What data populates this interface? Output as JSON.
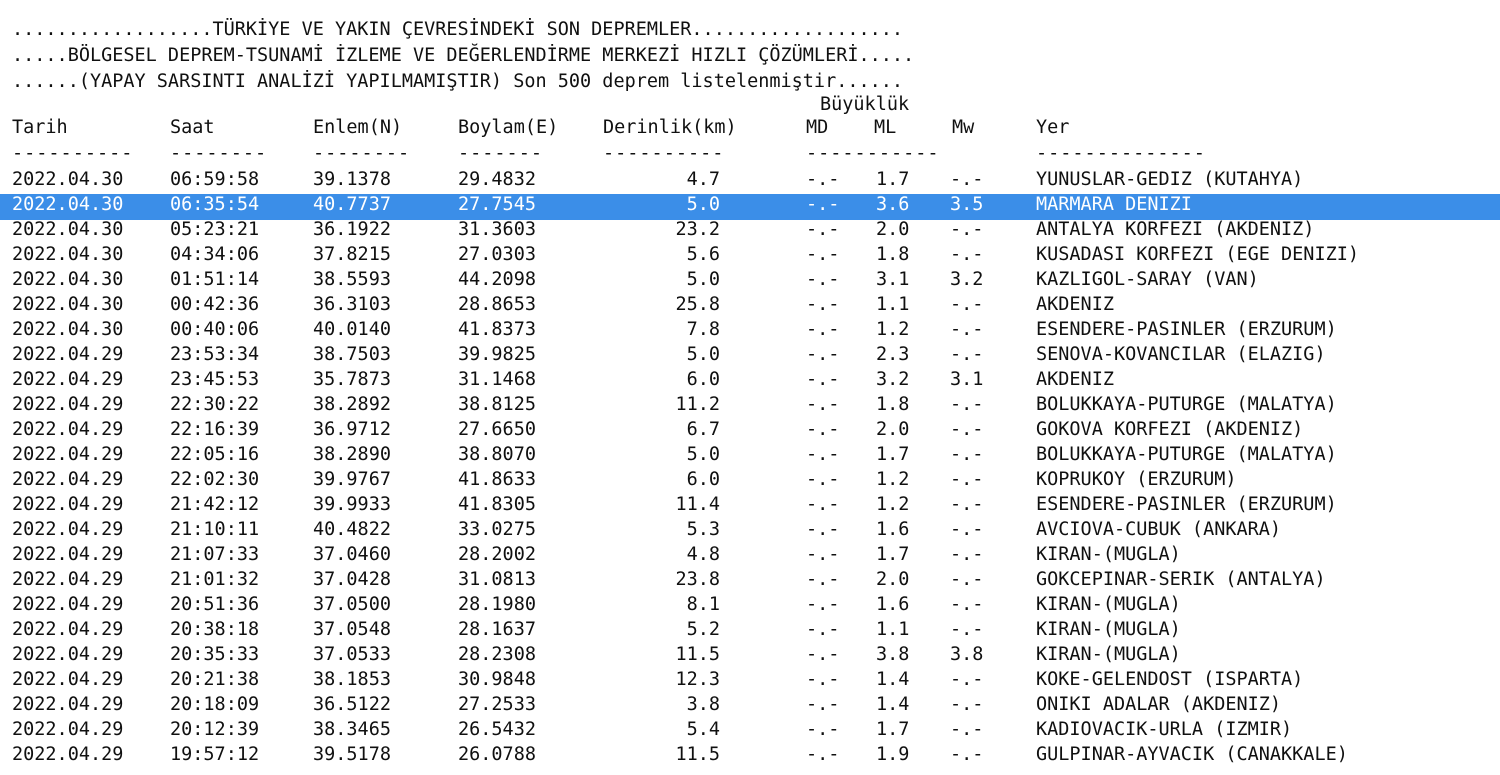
{
  "header": {
    "line1": "..................TÜRKİYE VE YAKIN ÇEVRESİNDEKİ SON DEPREMLER...................",
    "line2": ".....BÖLGESEL DEPREM-TSUNAMİ İZLEME VE DEĞERLENDİRME MERKEZİ HIZLI ÇÖZÜMLERİ.....",
    "line3": "......(YAPAY SARSINTI ANALİZİ YAPILMAMIŞTIR) Son 500 deprem listelenmiştir......",
    "magnitude_group": "Büyüklük"
  },
  "columns": {
    "date": "Tarih",
    "time": "Saat",
    "lat": "Enlem(N)",
    "lon": "Boylam(E)",
    "depth": "Derinlik(km)",
    "md": "MD",
    "ml": "ML",
    "mw": "Mw",
    "place": "Yer"
  },
  "separators": {
    "date": "----------",
    "time": "--------",
    "lat": "--------",
    "lon": "-------",
    "depth": "----------",
    "mag": "-----------",
    "place": "--------------"
  },
  "selected_index": 1,
  "rows": [
    {
      "date": "2022.04.30",
      "time": "06:59:58",
      "lat": "39.1378",
      "lon": "29.4832",
      "depth": "4.7",
      "md": "-.-",
      "ml": "1.7",
      "mw": "-.-",
      "place": "YUNUSLAR-GEDIZ (KUTAHYA)"
    },
    {
      "date": "2022.04.30",
      "time": "06:35:54",
      "lat": "40.7737",
      "lon": "27.7545",
      "depth": "5.0",
      "md": "-.-",
      "ml": "3.6",
      "mw": "3.5",
      "place": "MARMARA DENIZI"
    },
    {
      "date": "2022.04.30",
      "time": "05:23:21",
      "lat": "36.1922",
      "lon": "31.3603",
      "depth": "23.2",
      "md": "-.-",
      "ml": "2.0",
      "mw": "-.-",
      "place": "ANTALYA KORFEZI (AKDENIZ)"
    },
    {
      "date": "2022.04.30",
      "time": "04:34:06",
      "lat": "37.8215",
      "lon": "27.0303",
      "depth": "5.6",
      "md": "-.-",
      "ml": "1.8",
      "mw": "-.-",
      "place": "KUSADASI KORFEZI (EGE DENIZI)"
    },
    {
      "date": "2022.04.30",
      "time": "01:51:14",
      "lat": "38.5593",
      "lon": "44.2098",
      "depth": "5.0",
      "md": "-.-",
      "ml": "3.1",
      "mw": "3.2",
      "place": "KAZLIGOL-SARAY (VAN)"
    },
    {
      "date": "2022.04.30",
      "time": "00:42:36",
      "lat": "36.3103",
      "lon": "28.8653",
      "depth": "25.8",
      "md": "-.-",
      "ml": "1.1",
      "mw": "-.-",
      "place": "AKDENIZ"
    },
    {
      "date": "2022.04.30",
      "time": "00:40:06",
      "lat": "40.0140",
      "lon": "41.8373",
      "depth": "7.8",
      "md": "-.-",
      "ml": "1.2",
      "mw": "-.-",
      "place": "ESENDERE-PASINLER (ERZURUM)"
    },
    {
      "date": "2022.04.29",
      "time": "23:53:34",
      "lat": "38.7503",
      "lon": "39.9825",
      "depth": "5.0",
      "md": "-.-",
      "ml": "2.3",
      "mw": "-.-",
      "place": "SENOVA-KOVANCILAR (ELAZIG)"
    },
    {
      "date": "2022.04.29",
      "time": "23:45:53",
      "lat": "35.7873",
      "lon": "31.1468",
      "depth": "6.0",
      "md": "-.-",
      "ml": "3.2",
      "mw": "3.1",
      "place": "AKDENIZ"
    },
    {
      "date": "2022.04.29",
      "time": "22:30:22",
      "lat": "38.2892",
      "lon": "38.8125",
      "depth": "11.2",
      "md": "-.-",
      "ml": "1.8",
      "mw": "-.-",
      "place": "BOLUKKAYA-PUTURGE (MALATYA)"
    },
    {
      "date": "2022.04.29",
      "time": "22:16:39",
      "lat": "36.9712",
      "lon": "27.6650",
      "depth": "6.7",
      "md": "-.-",
      "ml": "2.0",
      "mw": "-.-",
      "place": "GOKOVA KORFEZI (AKDENIZ)"
    },
    {
      "date": "2022.04.29",
      "time": "22:05:16",
      "lat": "38.2890",
      "lon": "38.8070",
      "depth": "5.0",
      "md": "-.-",
      "ml": "1.7",
      "mw": "-.-",
      "place": "BOLUKKAYA-PUTURGE (MALATYA)"
    },
    {
      "date": "2022.04.29",
      "time": "22:02:30",
      "lat": "39.9767",
      "lon": "41.8633",
      "depth": "6.0",
      "md": "-.-",
      "ml": "1.2",
      "mw": "-.-",
      "place": "KOPRUKOY (ERZURUM)"
    },
    {
      "date": "2022.04.29",
      "time": "21:42:12",
      "lat": "39.9933",
      "lon": "41.8305",
      "depth": "11.4",
      "md": "-.-",
      "ml": "1.2",
      "mw": "-.-",
      "place": "ESENDERE-PASINLER (ERZURUM)"
    },
    {
      "date": "2022.04.29",
      "time": "21:10:11",
      "lat": "40.4822",
      "lon": "33.0275",
      "depth": "5.3",
      "md": "-.-",
      "ml": "1.6",
      "mw": "-.-",
      "place": "AVCIOVA-CUBUK (ANKARA)"
    },
    {
      "date": "2022.04.29",
      "time": "21:07:33",
      "lat": "37.0460",
      "lon": "28.2002",
      "depth": "4.8",
      "md": "-.-",
      "ml": "1.7",
      "mw": "-.-",
      "place": "KIRAN-(MUGLA)"
    },
    {
      "date": "2022.04.29",
      "time": "21:01:32",
      "lat": "37.0428",
      "lon": "31.0813",
      "depth": "23.8",
      "md": "-.-",
      "ml": "2.0",
      "mw": "-.-",
      "place": "GOKCEPINAR-SERIK (ANTALYA)"
    },
    {
      "date": "2022.04.29",
      "time": "20:51:36",
      "lat": "37.0500",
      "lon": "28.1980",
      "depth": "8.1",
      "md": "-.-",
      "ml": "1.6",
      "mw": "-.-",
      "place": "KIRAN-(MUGLA)"
    },
    {
      "date": "2022.04.29",
      "time": "20:38:18",
      "lat": "37.0548",
      "lon": "28.1637",
      "depth": "5.2",
      "md": "-.-",
      "ml": "1.1",
      "mw": "-.-",
      "place": "KIRAN-(MUGLA)"
    },
    {
      "date": "2022.04.29",
      "time": "20:35:33",
      "lat": "37.0533",
      "lon": "28.2308",
      "depth": "11.5",
      "md": "-.-",
      "ml": "3.8",
      "mw": "3.8",
      "place": "KIRAN-(MUGLA)"
    },
    {
      "date": "2022.04.29",
      "time": "20:21:38",
      "lat": "38.1853",
      "lon": "30.9848",
      "depth": "12.3",
      "md": "-.-",
      "ml": "1.4",
      "mw": "-.-",
      "place": "KOKE-GELENDOST (ISPARTA)"
    },
    {
      "date": "2022.04.29",
      "time": "20:18:09",
      "lat": "36.5122",
      "lon": "27.2533",
      "depth": "3.8",
      "md": "-.-",
      "ml": "1.4",
      "mw": "-.-",
      "place": "ONIKI ADALAR (AKDENIZ)"
    },
    {
      "date": "2022.04.29",
      "time": "20:12:39",
      "lat": "38.3465",
      "lon": "26.5432",
      "depth": "5.4",
      "md": "-.-",
      "ml": "1.7",
      "mw": "-.-",
      "place": "KADIOVACIK-URLA (IZMIR)"
    },
    {
      "date": "2022.04.29",
      "time": "19:57:12",
      "lat": "39.5178",
      "lon": "26.0788",
      "depth": "11.5",
      "md": "-.-",
      "ml": "1.9",
      "mw": "-.-",
      "place": "GULPINAR-AYVACIK (CANAKKALE)"
    }
  ],
  "colors": {
    "selection": "#3b8ee8",
    "selection_text": "#ffffff",
    "text": "#101010"
  }
}
